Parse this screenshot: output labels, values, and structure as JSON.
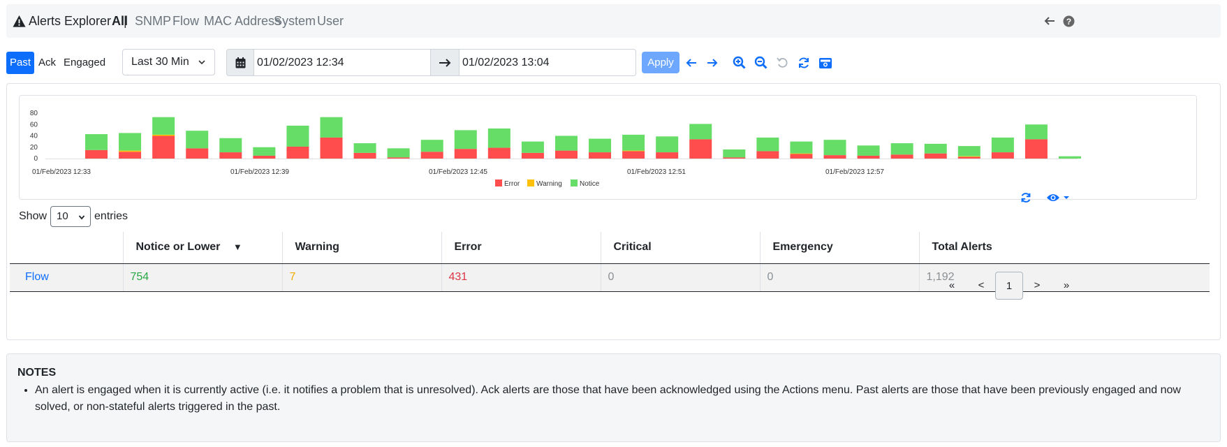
{
  "navbar": {
    "title": "Alerts Explorer",
    "separator": "|",
    "tabs": [
      "All",
      "SNMP",
      "Flow",
      "MAC Address",
      "System",
      "User"
    ],
    "active_tab": "All",
    "right_icons": [
      "arrow-left-icon",
      "help-icon"
    ]
  },
  "toolbar": {
    "status_buttons": [
      "Past",
      "Ack",
      "Engaged"
    ],
    "active_status": "Past",
    "range_select": "Last 30 Min",
    "start_date": "01/02/2023 12:34",
    "end_date": "01/02/2023 13:04",
    "apply_label": "Apply",
    "icons": [
      "arrow-left-icon",
      "arrow-right-icon",
      "zoom-in-icon",
      "zoom-out-icon",
      "undo-icon",
      "refresh-icon",
      "camera-icon"
    ]
  },
  "chart_data": {
    "type": "bar",
    "stacked": true,
    "x_tick_labels": [
      "01/Feb/2023 12:33",
      "01/Feb/2023 12:39",
      "01/Feb/2023 12:45",
      "01/Feb/2023 12:51",
      "01/Feb/2023 12:57"
    ],
    "y_ticks": [
      0,
      20,
      40,
      60,
      80
    ],
    "ylim": [
      0,
      80
    ],
    "grid": false,
    "legend_position": "bottom-center",
    "series": [
      {
        "name": "Error",
        "color": "#ff4d4d",
        "values": [
          15,
          12,
          40,
          18,
          11,
          5,
          21,
          37,
          10,
          2,
          12,
          17,
          19,
          10,
          14,
          11,
          13,
          11,
          34,
          2,
          13,
          8,
          6,
          5,
          7,
          9,
          3,
          11,
          34,
          0
        ]
      },
      {
        "name": "Warning",
        "color": "#ffc107",
        "values": [
          0,
          2,
          2,
          0,
          0,
          0,
          0,
          0,
          0,
          0,
          0,
          0,
          0,
          0,
          0,
          0,
          1,
          0,
          0,
          0,
          0,
          1,
          0,
          0,
          0,
          0,
          1,
          0,
          0,
          0
        ]
      },
      {
        "name": "Notice",
        "color": "#66dd66",
        "values": [
          28,
          31,
          31,
          31,
          25,
          15,
          37,
          36,
          17,
          16,
          21,
          33,
          34,
          20,
          26,
          24,
          28,
          28,
          27,
          14,
          24,
          21,
          27,
          18,
          20,
          17,
          18,
          26,
          26,
          4
        ]
      }
    ]
  },
  "table": {
    "show_label": "Show",
    "entries_value": "10",
    "entries_label": "entries",
    "columns": [
      "",
      "Notice or Lower",
      "Warning",
      "Error",
      "Critical",
      "Emergency",
      "Total Alerts"
    ],
    "sort_indicator": "▼",
    "rows": [
      {
        "name": "Flow",
        "notice": "754",
        "warning": "7",
        "error": "431",
        "critical": "0",
        "emergency": "0",
        "total": "1,192"
      }
    ],
    "colors": {
      "link": "#0d6efd",
      "notice": "#28a745",
      "warning": "#f0ad00",
      "error": "#dc3545",
      "muted": "#8a8f94"
    }
  },
  "pagination": {
    "first": "«",
    "prev": "<",
    "current": "1",
    "next": ">",
    "last": "»"
  },
  "notes": {
    "title": "NOTES",
    "items": [
      "An alert is engaged when it is currently active (i.e. it notifies a problem that is unresolved). Ack alerts are those that have been acknowledged using the Actions menu. Past alerts are those that have been previously engaged and now solved, or non-stateful alerts triggered in the past."
    ]
  }
}
